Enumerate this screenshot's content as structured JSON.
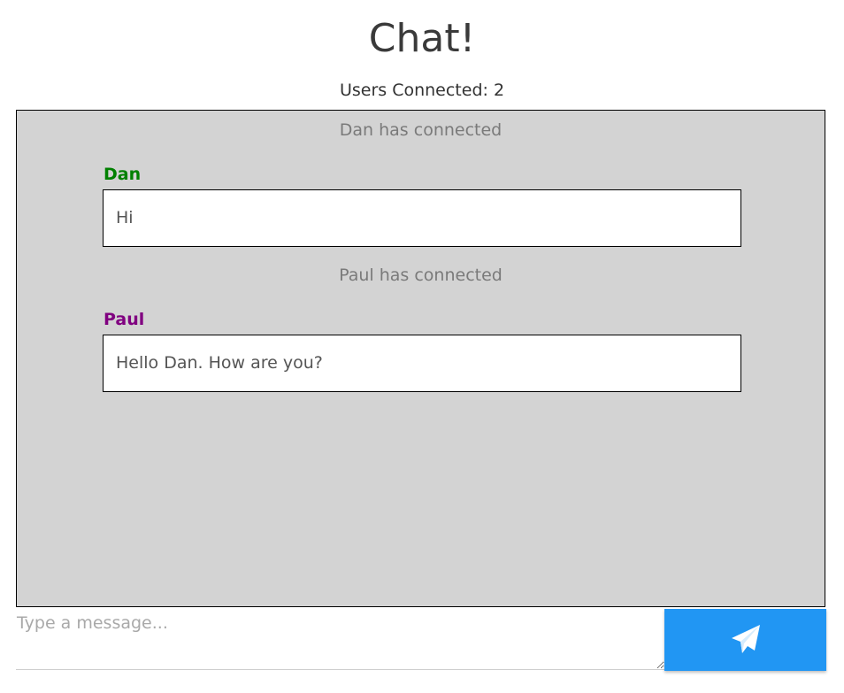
{
  "header": {
    "title": "Chat!",
    "users_connected": "Users Connected: 2"
  },
  "chat": {
    "background_color": "#d3d3d3",
    "events": [
      {
        "type": "system",
        "text": "Dan has connected"
      },
      {
        "type": "message",
        "author": "Dan",
        "author_color": "#008000",
        "text": "Hi"
      },
      {
        "type": "system",
        "text": "Paul has connected"
      },
      {
        "type": "message",
        "author": "Paul",
        "author_color": "#800080",
        "text": "Hello Dan. How are you?"
      }
    ]
  },
  "composer": {
    "value": "",
    "placeholder": "Type a message..."
  },
  "send": {
    "icon": "paper-plane-icon",
    "color": "#2196f3"
  }
}
